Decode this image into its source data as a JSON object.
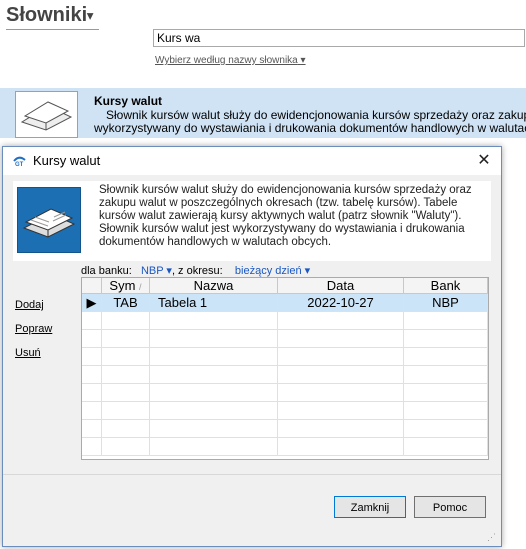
{
  "bg": {
    "title": "Słowniki",
    "search_value": "Kurs wa",
    "choose_link": "Wybierz według nazwy słownika",
    "heading": "Kursy walut",
    "desc_line1": "Słownik kursów walut służy do ewidencjonowania kursów sprzedaży oraz zakupu",
    "desc_line2": "wykorzystywany do wystawiania i drukowania dokumentów handlowych w walutach"
  },
  "dialog": {
    "title": "Kursy walut",
    "description": "Słownik kursów walut służy do ewidencjonowania kursów sprzedaży oraz zakupu walut w poszczególnych okresach (tzw. tabelę kursów). Tabele kursów walut zawierają kursy aktywnych walut (patrz słownik \"Waluty\"). Słownik kursów walut jest wykorzystywany do wystawiania i drukowania dokumentów handlowych w walutach obcych.",
    "filter": {
      "bank_label": "dla banku:",
      "bank_value": "NBP",
      "period_label": ", z okresu:",
      "period_value": "bieżący dzień"
    },
    "actions": {
      "add": "Dodaj",
      "edit": "Popraw",
      "delete": "Usuń"
    },
    "columns": {
      "sym": "Sym",
      "nazwa": "Nazwa",
      "data": "Data",
      "bank": "Bank"
    },
    "rows": [
      {
        "sym": "TAB",
        "nazwa": "Tabela 1",
        "data": "2022-10-27",
        "bank": "NBP"
      }
    ],
    "buttons": {
      "close": "Zamknij",
      "help": "Pomoc"
    }
  },
  "icons": {
    "dialog_title_icon": "app-logo-icon",
    "close": "close-icon",
    "row_pointer": "row-pointer-icon",
    "dropdown": "chevron-down-icon"
  },
  "colors": {
    "accent": "#1a57c2",
    "selection": "#cce4f7",
    "band": "#cfe3f5"
  }
}
